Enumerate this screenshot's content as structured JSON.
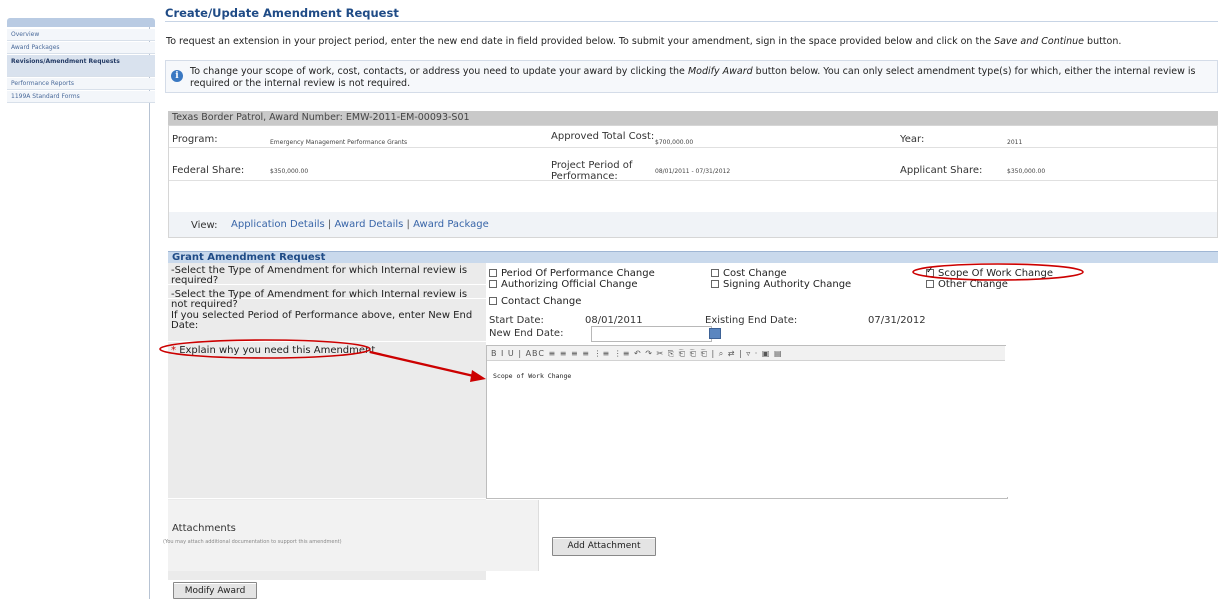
{
  "sidebar": {
    "items": [
      {
        "label": "Overview"
      },
      {
        "label": "Award Packages"
      },
      {
        "label": "Revisions/Amendment Requests"
      },
      {
        "label": "Performance Reports"
      },
      {
        "label": "1199A Standard Forms"
      }
    ]
  },
  "page": {
    "title": "Create/Update Amendment Request",
    "intro_prefix": "To request an extension in your project period, enter the new end date in field provided below. To submit your amendment, sign in the space provided below and click on the ",
    "intro_emph": "Save and Continue",
    "intro_suffix": " button.",
    "info_prefix": "To change your scope of work, cost, contacts, or address you need to update your award by clicking the ",
    "info_emph": "Modify Award",
    "info_suffix": " button below. You can only select amendment type(s) for which, either the internal review is required or the internal review is not required."
  },
  "award": {
    "header": "Texas Border Patrol, Award Number: EMW-2011-EM-00093-S01",
    "program_label": "Program:",
    "program_value": "Emergency Management Performance Grants",
    "approved_cost_label": "Approved Total Cost:",
    "approved_cost_value": "$700,000.00",
    "year_label": "Year:",
    "year_value": "2011",
    "federal_share_label": "Federal Share:",
    "federal_share_value": "$350,000.00",
    "period_label": "Project Period of Performance:",
    "period_value": "08/01/2011 - 07/31/2012",
    "applicant_share_label": "Applicant Share:",
    "applicant_share_value": "$350,000.00",
    "view_label": "View:",
    "links": [
      "Application Details",
      "Award Details",
      "Award Package"
    ],
    "sep": "|"
  },
  "amendment": {
    "header": "Grant Amendment Request",
    "q_internal_required": "-Select the Type of Amendment for which Internal review is required?",
    "q_internal_not_required": "-Select the Type of Amendment for which Internal review is not required?",
    "q_new_end_date": "If you selected Period of Performance above, enter New End Date:",
    "options_required": [
      {
        "label": "Period Of Performance Change",
        "checked": false
      },
      {
        "label": "Cost Change",
        "checked": false
      },
      {
        "label": "Scope Of Work Change",
        "checked": true
      },
      {
        "label": "Authorizing Official Change",
        "checked": false
      },
      {
        "label": "Signing Authority Change",
        "checked": false
      },
      {
        "label": "Other Change",
        "checked": false
      }
    ],
    "options_not_required": [
      {
        "label": "Contact Change",
        "checked": false
      }
    ],
    "start_date_label": "Start Date:",
    "start_date_value": "08/01/2011",
    "existing_end_label": "Existing End Date:",
    "existing_end_value": "07/31/2012",
    "new_end_label": "New End Date:",
    "new_end_value": "",
    "explain_label": "Explain why you need this Amendment",
    "required_mark": "*",
    "editor_toolbar": "B I U | ABC ≡ ≡ ≡ ≡ ⋮≡ ⋮≡ ↶ ↷ ✂ ⎘ ⎗ ⎗ ⎗ | ⌕ ⇄ | ▿ · ▣ ▤",
    "editor_text": "Scope of Work Change",
    "attachments_label": "Attachments",
    "attachments_help": "(You may attach additional documentation to support this amendment)",
    "add_attachment_button": "Add Attachment",
    "modify_award_button": "Modify Award"
  },
  "colors": {
    "accent": "#1f4b86",
    "annotation": "#cc0000"
  }
}
